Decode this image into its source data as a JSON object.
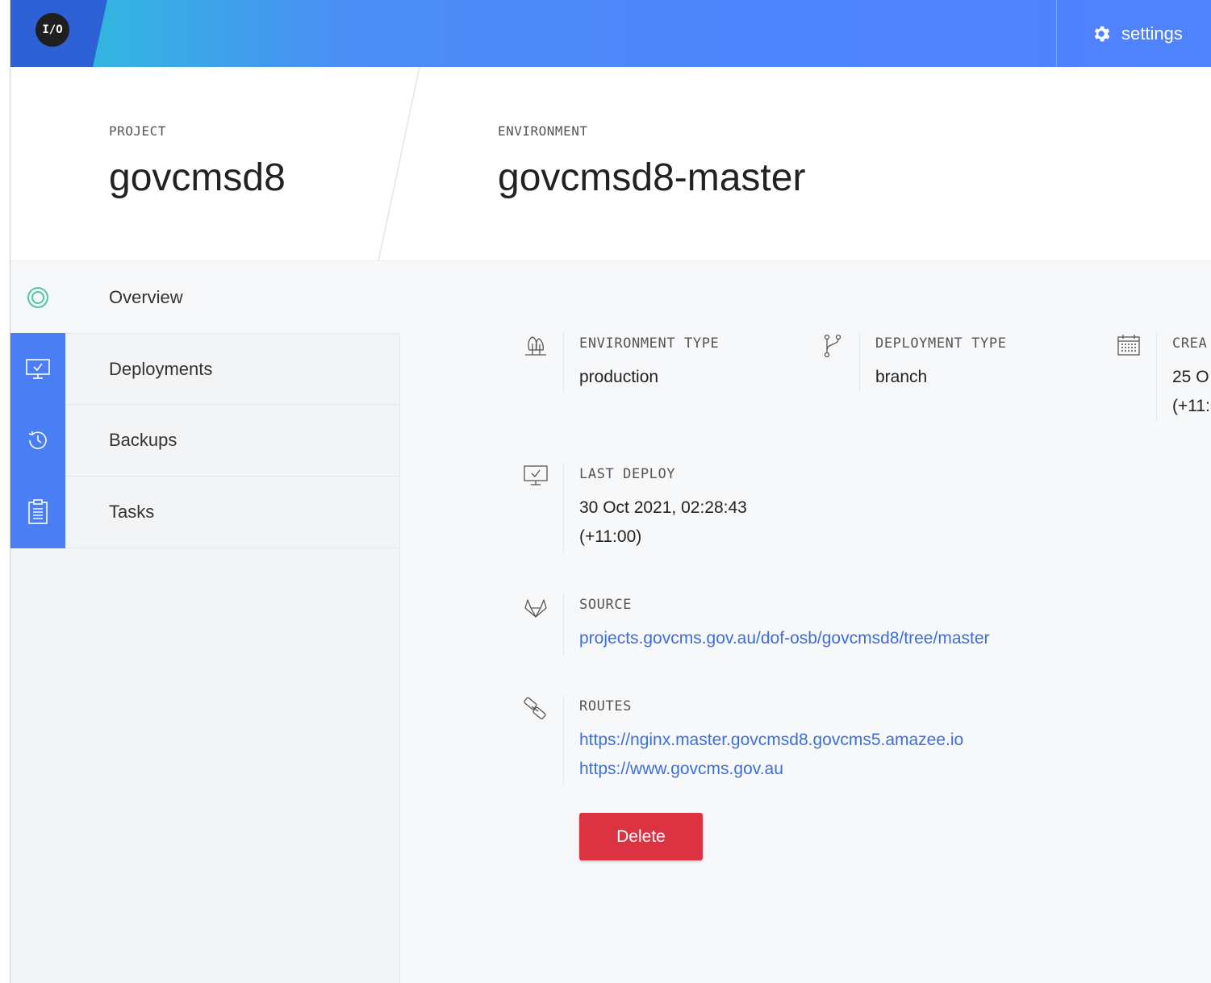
{
  "header": {
    "logo_text": "I/O",
    "settings_label": "settings"
  },
  "titles": {
    "project_label": "PROJECT",
    "project_name": "govcmsd8",
    "environment_label": "ENVIRONMENT",
    "environment_name": "govcmsd8-master"
  },
  "sidebar": {
    "items": [
      {
        "label": "Overview",
        "icon": "target-icon"
      },
      {
        "label": "Deployments",
        "icon": "monitor-check-icon"
      },
      {
        "label": "Backups",
        "icon": "history-icon"
      },
      {
        "label": "Tasks",
        "icon": "clipboard-icon"
      }
    ]
  },
  "details": {
    "environment_type": {
      "label": "ENVIRONMENT TYPE",
      "value": "production"
    },
    "deployment_type": {
      "label": "DEPLOYMENT TYPE",
      "value": "branch"
    },
    "created": {
      "label": "CREA",
      "value_line1": "25 O",
      "value_line2": "(+11:"
    },
    "last_deploy": {
      "label": "LAST DEPLOY",
      "value_line1": "30 Oct 2021, 02:28:43",
      "value_line2": "(+11:00)"
    },
    "source": {
      "label": "SOURCE",
      "link": "projects.govcms.gov.au/dof-osb/govcmsd8/tree/master"
    },
    "routes": {
      "label": "ROUTES",
      "links": [
        "https://nginx.master.govcmsd8.govcms5.amazee.io",
        "https://www.govcms.gov.au"
      ]
    }
  },
  "actions": {
    "delete_label": "Delete"
  },
  "colors": {
    "header_blue": "#4f82fd",
    "nav_icon_blue": "#4a7ef5",
    "link_blue": "#3c6fd8",
    "delete_red": "#dc3343",
    "overview_green": "#4cc9a4"
  }
}
